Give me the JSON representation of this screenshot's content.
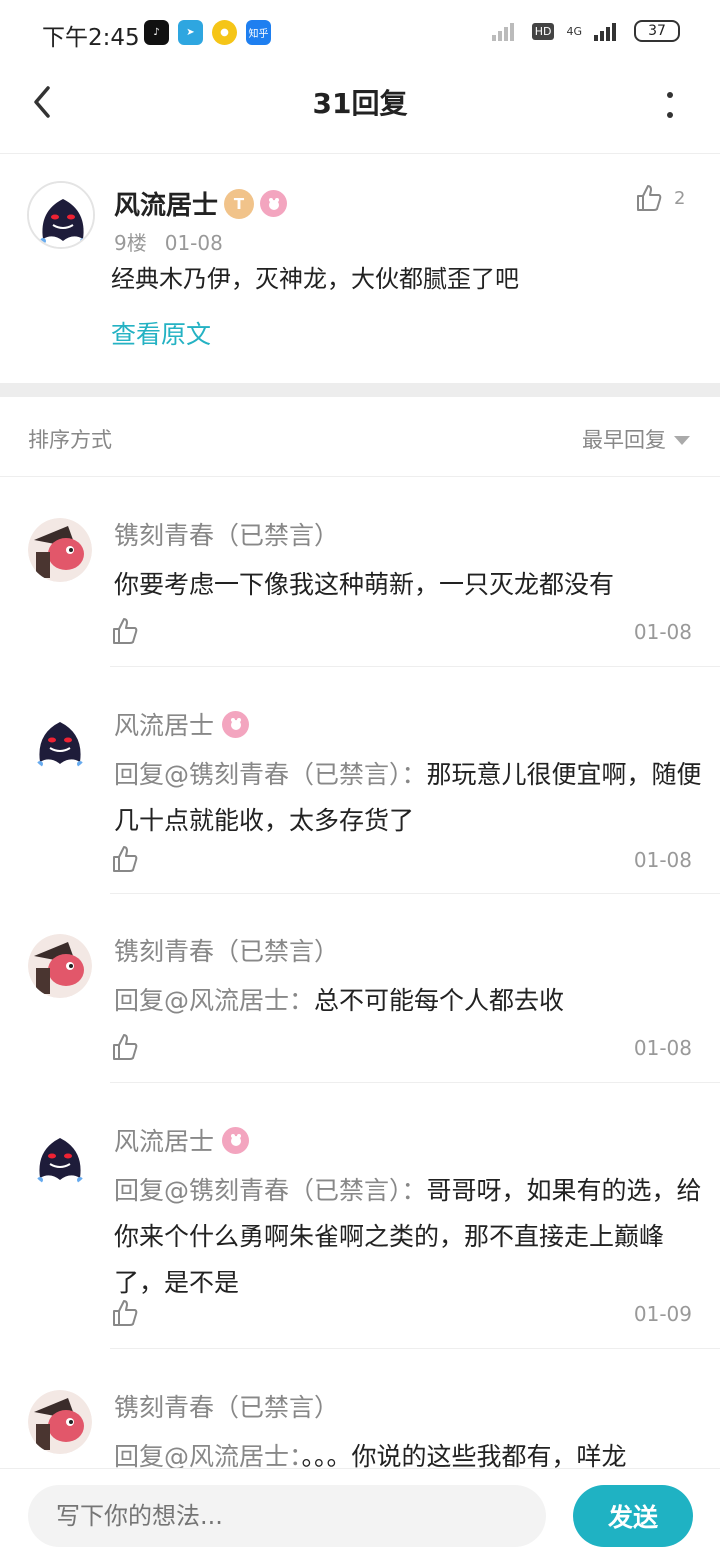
{
  "status_bar": {
    "time": "下午2:45",
    "apps": [
      {
        "icon": "tiktok-icon",
        "label": "",
        "color": "#111111"
      },
      {
        "icon": "telegram-icon",
        "label": "",
        "color": "#2ea6e0"
      },
      {
        "icon": "weibo-like-icon",
        "label": "",
        "color": "#f5c518"
      },
      {
        "icon": "zhihu-icon",
        "label": "知乎",
        "color": "#1e7ff0"
      }
    ],
    "hd": "HD",
    "network": "4G",
    "battery": "37"
  },
  "header": {
    "title": "31回复"
  },
  "post": {
    "user": "风流居士",
    "badge_t": "T",
    "floor": "9楼",
    "date": "01-08",
    "text": "经典木乃伊，灭神龙，大伙都腻歪了吧",
    "view_original": "查看原文",
    "likes": "2"
  },
  "sort": {
    "label": "排序方式",
    "value": "最早回复"
  },
  "replies": [
    {
      "user": "镌刻青春（已禁言）",
      "at": "",
      "text": "你要考虑一下像我这种萌新，一只灭龙都没有",
      "date": "01-08"
    },
    {
      "user": "风流居士",
      "at": "回复@镌刻青春（已禁言）：",
      "text": "那玩意儿很便宜啊，随便几十点就能收，太多存货了",
      "date": "01-08"
    },
    {
      "user": "镌刻青春（已禁言）",
      "at": "回复@风流居士：",
      "text": "总不可能每个人都去收",
      "date": "01-08"
    },
    {
      "user": "风流居士",
      "at": "回复@镌刻青春（已禁言）：",
      "text": "哥哥呀，如果有的选，给你来个什么勇啊朱雀啊之类的，那不直接走上巅峰了，是不是",
      "date": "01-09"
    },
    {
      "user": "镌刻青春（已禁言）",
      "at": "回复@风流居士：",
      "text": "。。。你说的这些我都有，咩龙",
      "date": ""
    }
  ],
  "input": {
    "placeholder": "写下你的想法..."
  },
  "send_label": "发送",
  "colors": {
    "accent": "#1fb2c3",
    "link": "#24b2c3",
    "badge_pink": "#f3a5bf",
    "badge_gold": "#f1c38a"
  }
}
